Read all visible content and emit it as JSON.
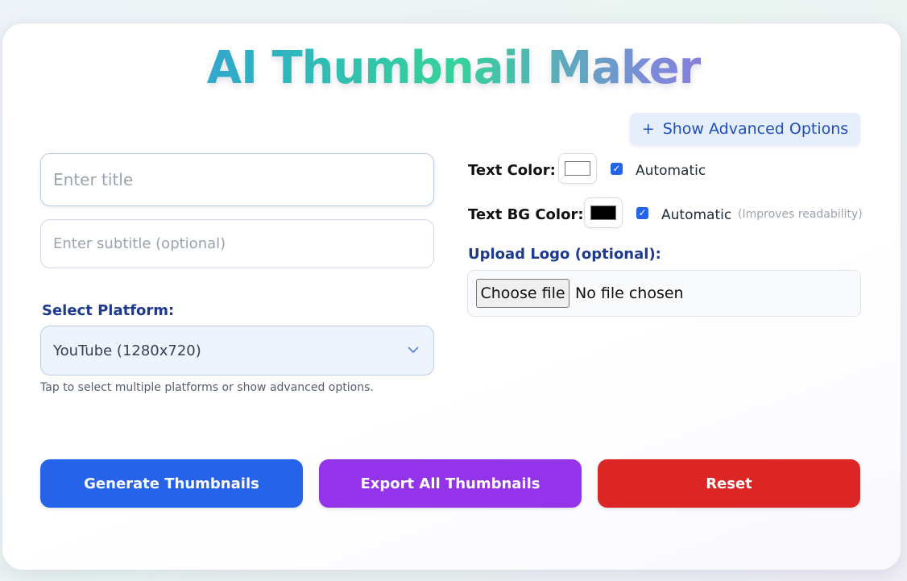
{
  "header": {
    "title": "AI Thumbnail Maker"
  },
  "advanced_toggle": {
    "icon": "+",
    "label": "Show Advanced Options"
  },
  "form": {
    "title_placeholder": "Enter title",
    "subtitle_placeholder": "Enter subtitle (optional)",
    "platform_label": "Select Platform:",
    "platform_selected": "YouTube (1280x720)",
    "platform_hint": "Tap to select multiple platforms or show advanced options."
  },
  "style": {
    "text_color_label": "Text Color:",
    "text_color_value": "#ffffff",
    "text_color_auto_label": "Automatic",
    "text_color_auto_checked": true,
    "text_bg_color_label": "Text BG Color:",
    "text_bg_color_value": "#000000",
    "text_bg_auto_label": "Automatic",
    "text_bg_auto_checked": true,
    "text_bg_note": "(Improves readability)"
  },
  "logo": {
    "label": "Upload Logo (optional):",
    "choose_label": "Choose file",
    "status": "No file chosen"
  },
  "actions": {
    "generate_label": "Generate Thumbnails",
    "generate_color": "#2563eb",
    "export_label": "Export All Thumbnails",
    "export_color": "#9333ea",
    "reset_label": "Reset",
    "reset_color": "#dc2626"
  }
}
